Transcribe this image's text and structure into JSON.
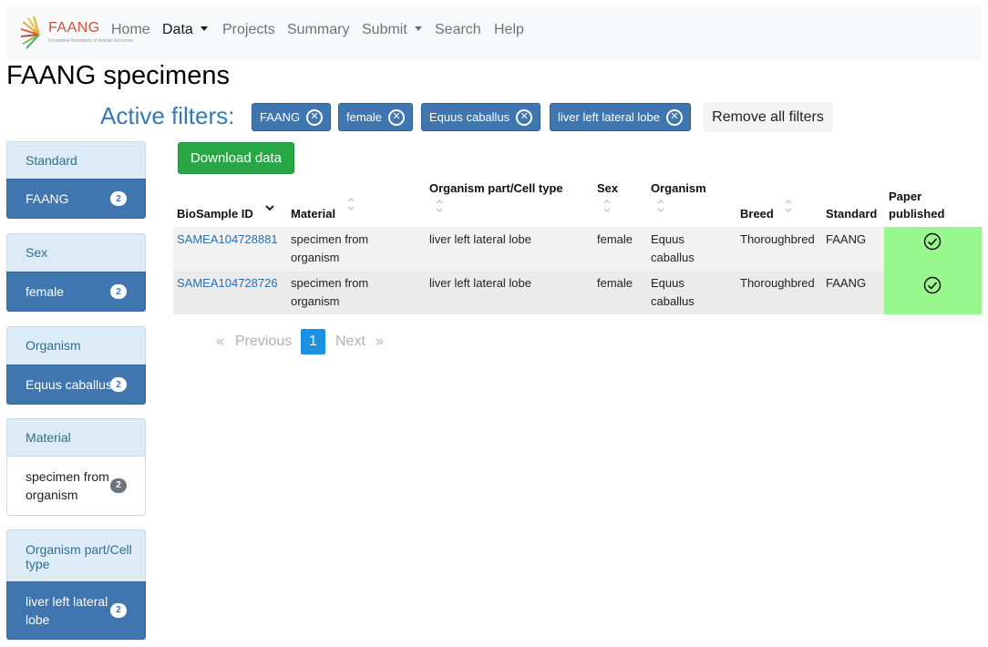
{
  "brand": {
    "name": "FAANG",
    "subtitle": "Functional Annotation of Animal Genomes"
  },
  "nav": {
    "home": "Home",
    "data": "Data",
    "projects": "Projects",
    "summary": "Summary",
    "submit": "Submit",
    "search": "Search",
    "help": "Help"
  },
  "page_title": "FAANG specimens",
  "active_filters": {
    "label": "Active filters:",
    "chips": [
      "FAANG",
      "female",
      "Equus caballus",
      "liver left lateral lobe"
    ],
    "remove_all": "Remove all filters"
  },
  "sidebar": [
    {
      "title": "Standard",
      "item": "FAANG",
      "count": "2"
    },
    {
      "title": "Sex",
      "item": "female",
      "count": "2"
    },
    {
      "title": "Organism",
      "item": "Equus caballus",
      "count": "2"
    },
    {
      "title": "Material",
      "item_lines": [
        "specimen from",
        "organism"
      ],
      "count": "2"
    },
    {
      "title_lines": [
        "Organism part/Cell",
        "type"
      ],
      "item_lines": [
        "liver left lateral",
        "lobe"
      ],
      "count": "2"
    }
  ],
  "download_label": "Download data",
  "table": {
    "headers": {
      "biosample_id": "BioSample ID",
      "material": "Material",
      "organism_part": "Organism part/Cell type",
      "sex": "Sex",
      "organism": "Organism",
      "breed": "Breed",
      "standard": "Standard",
      "paper_line1": "Paper",
      "paper_line2": "published"
    },
    "rows": [
      {
        "biosample_id": "SAMEA104728881",
        "material_l1": "specimen from",
        "material_l2": "organism",
        "organism_part": "liver left lateral lobe",
        "sex": "female",
        "organism_l1": "Equus",
        "organism_l2": "caballus",
        "breed": "Thoroughbred",
        "standard": "FAANG",
        "paper_published": true
      },
      {
        "biosample_id": "SAMEA104728726",
        "material_l1": "specimen from",
        "material_l2": "organism",
        "organism_part": "liver left lateral lobe",
        "sex": "female",
        "organism_l1": "Equus",
        "organism_l2": "caballus",
        "breed": "Thoroughbred",
        "standard": "FAANG",
        "paper_published": true
      }
    ]
  },
  "pagination": {
    "first": "«",
    "previous": "Previous",
    "current": "1",
    "next": "Next",
    "last": "»"
  },
  "colors": {
    "primary": "#3f76b0",
    "success": "#28a745",
    "paper_cell": "#98f78f",
    "link": "#2a6eb0",
    "filters_label": "#337ab7"
  }
}
